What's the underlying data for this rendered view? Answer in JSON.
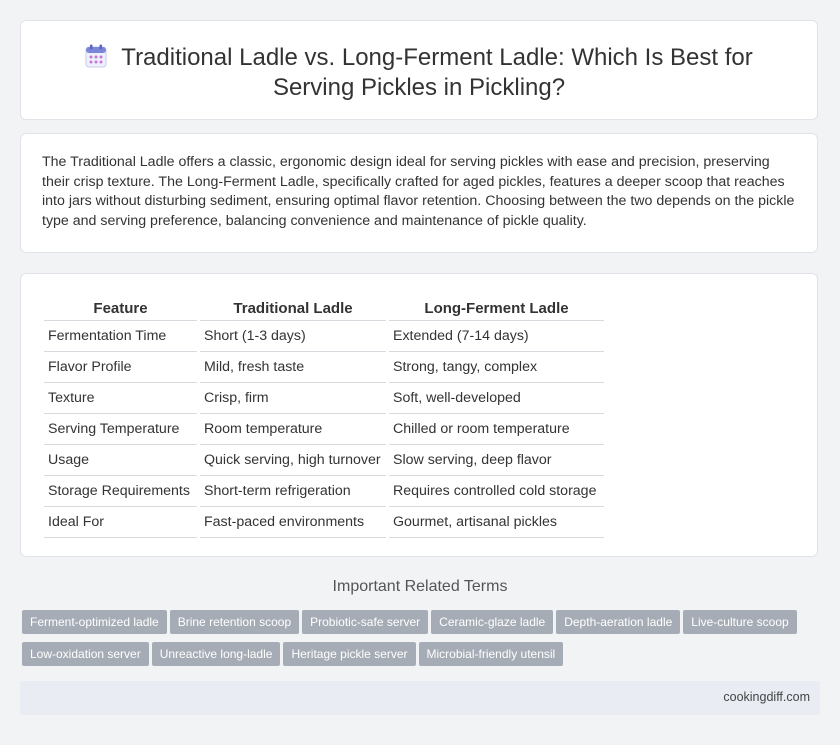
{
  "header": {
    "title_line1": "Traditional Ladle vs. Long-Ferment Ladle: Which Is Best for",
    "title_line2": "Serving Pickles in Pickling?",
    "icon": "calendar-icon"
  },
  "intro": {
    "text": "The Traditional Ladle offers a classic, ergonomic design ideal for serving pickles with ease and precision, preserving their crisp texture. The Long-Ferment Ladle, specifically crafted for aged pickles, features a deeper scoop that reaches into jars without disturbing sediment, ensuring optimal flavor retention. Choosing between the two depends on the pickle type and serving preference, balancing convenience and maintenance of pickle quality."
  },
  "table": {
    "headers": [
      "Feature",
      "Traditional Ladle",
      "Long-Ferment Ladle"
    ],
    "rows": [
      [
        "Fermentation Time",
        "Short (1-3 days)",
        "Extended (7-14 days)"
      ],
      [
        "Flavor Profile",
        "Mild, fresh taste",
        "Strong, tangy, complex"
      ],
      [
        "Texture",
        "Crisp, firm",
        "Soft, well-developed"
      ],
      [
        "Serving Temperature",
        "Room temperature",
        "Chilled or room temperature"
      ],
      [
        "Usage",
        "Quick serving, high turnover",
        "Slow serving, deep flavor"
      ],
      [
        "Storage Requirements",
        "Short-term refrigeration",
        "Requires controlled cold storage"
      ],
      [
        "Ideal For",
        "Fast-paced environments",
        "Gourmet, artisanal pickles"
      ]
    ]
  },
  "related": {
    "title": "Important Related Terms",
    "tags": [
      "Ferment-optimized ladle",
      "Brine retention scoop",
      "Probiotic-safe server",
      "Ceramic-glaze ladle",
      "Depth-aeration ladle",
      "Live-culture scoop",
      "Low-oxidation server",
      "Unreactive long-ladle",
      "Heritage pickle server",
      "Microbial-friendly utensil"
    ]
  },
  "footer": {
    "site": "cookingdiff.com"
  }
}
